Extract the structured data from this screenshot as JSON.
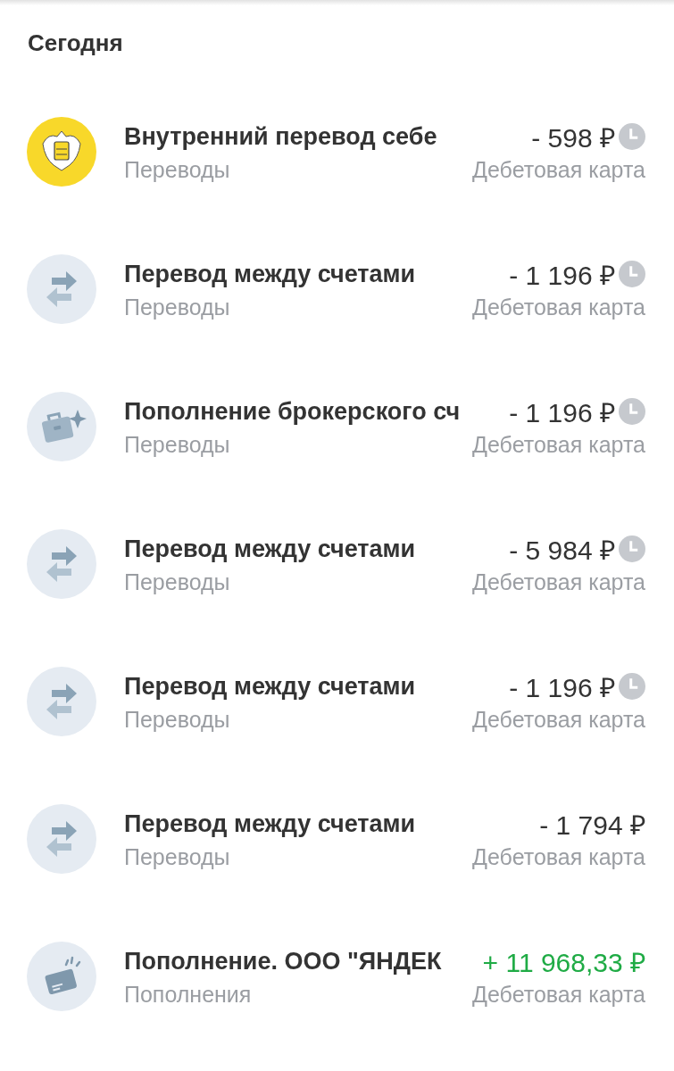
{
  "section_title": "Сегодня",
  "operations": [
    {
      "kind": "bank",
      "title": "Внутренний перевод себе",
      "category": "Переводы",
      "amount": "- 598 ₽",
      "incoming": false,
      "pending": true,
      "account": "Дебетовая карта"
    },
    {
      "kind": "transfer",
      "title": "Перевод между счетами",
      "category": "Переводы",
      "amount": "- 1 196 ₽",
      "incoming": false,
      "pending": true,
      "account": "Дебетовая карта"
    },
    {
      "kind": "briefcase",
      "title": "Пополнение брокерского сч",
      "category": "Переводы",
      "amount": "- 1 196 ₽",
      "incoming": false,
      "pending": true,
      "account": "Дебетовая карта"
    },
    {
      "kind": "transfer",
      "title": "Перевод между счетами",
      "category": "Переводы",
      "amount": "- 5 984 ₽",
      "incoming": false,
      "pending": true,
      "account": "Дебетовая карта"
    },
    {
      "kind": "transfer",
      "title": "Перевод между счетами",
      "category": "Переводы",
      "amount": "- 1 196 ₽",
      "incoming": false,
      "pending": true,
      "account": "Дебетовая карта"
    },
    {
      "kind": "transfer",
      "title": "Перевод между счетами",
      "category": "Переводы",
      "amount": "- 1 794 ₽",
      "incoming": false,
      "pending": false,
      "account": "Дебетовая карта"
    },
    {
      "kind": "card",
      "title": "Пополнение. ООО \"ЯНДЕК",
      "category": "Пополнения",
      "amount": "+ 11 968,33 ₽",
      "incoming": true,
      "pending": false,
      "account": "Дебетовая карта"
    }
  ]
}
